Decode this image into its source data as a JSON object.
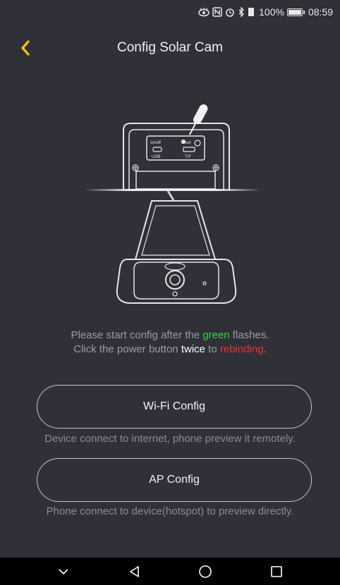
{
  "status_bar": {
    "battery": "100%",
    "time": "08:59"
  },
  "header": {
    "title": "Config Solar Cam",
    "back_icon": "chevron-left-icon",
    "accent_color": "#ffc107"
  },
  "illustration": {
    "labels": {
      "on_off": "on/off",
      "reset": "reset",
      "usb": "USB",
      "tf": "T/F"
    }
  },
  "instructions": {
    "line1_before": "Please start config after the ",
    "line1_highlight": "green",
    "line1_after": " flashes.",
    "line2_before": "Click the power button ",
    "line2_emphasis": "twice",
    "line2_middle": " to ",
    "line2_highlight": "rebinding",
    "line2_after": ".",
    "colors": {
      "green": "#37d63a",
      "red": "#ff2a2a"
    }
  },
  "wifi_config": {
    "button_label": "Wi-Fi Config",
    "description": "Device connect to internet, phone preview it remotely."
  },
  "ap_config": {
    "button_label": "AP Config",
    "description": "Phone connect to device(hotspot) to preview directly."
  },
  "nav_bar": {
    "items": [
      "chevron-down-icon",
      "back-triangle-icon",
      "home-circle-icon",
      "recents-square-icon"
    ]
  }
}
